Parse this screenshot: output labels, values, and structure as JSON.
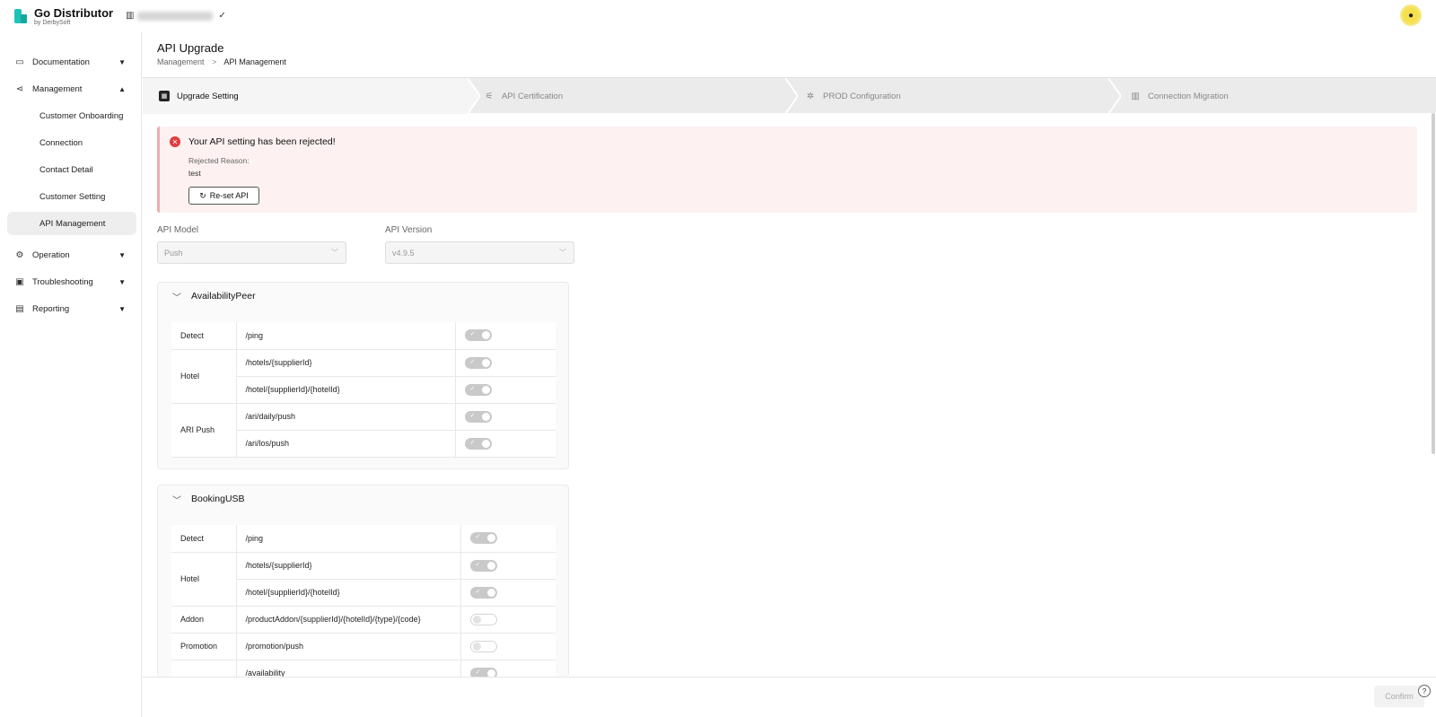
{
  "app": {
    "title": "Go Distributor",
    "subtitle": "by DerbySoft"
  },
  "org": {
    "icon": "building-icon",
    "check": "✓"
  },
  "sidebar": {
    "items": [
      {
        "label": "Documentation",
        "icon": "folder-icon",
        "caret": "▼"
      },
      {
        "label": "Management",
        "icon": "share-icon",
        "caret": "▲"
      },
      {
        "label": "Operation",
        "icon": "gear-icon",
        "caret": "▼"
      },
      {
        "label": "Troubleshooting",
        "icon": "monitor-icon",
        "caret": "▼"
      },
      {
        "label": "Reporting",
        "icon": "chart-icon",
        "caret": "▼"
      }
    ],
    "sub_items": [
      {
        "label": "Customer Onboarding"
      },
      {
        "label": "Connection"
      },
      {
        "label": "Contact Detail"
      },
      {
        "label": "Customer Setting"
      },
      {
        "label": "API Management"
      }
    ]
  },
  "header": {
    "title": "API Upgrade",
    "breadcrumb": {
      "parent": "Management",
      "sep": ">",
      "current": "API Management"
    }
  },
  "steps": [
    {
      "label": "Upgrade Setting"
    },
    {
      "label": "API Certification"
    },
    {
      "label": "PROD Configuration"
    },
    {
      "label": "Connection Migration"
    }
  ],
  "alert": {
    "title": "Your API setting has been rejected!",
    "reason_label": "Rejected Reason:",
    "reason_value": "test",
    "reset_button": "Re-set API"
  },
  "form": {
    "api_model_label": "API Model",
    "api_model_value": "Push",
    "api_version_label": "API Version",
    "api_version_value": "v4.9.5"
  },
  "panels": [
    {
      "title": "AvailabilityPeer",
      "groups": [
        "Detect",
        "Hotel",
        "ARI Push"
      ],
      "rows": [
        {
          "path": "/ping",
          "on": true
        },
        {
          "path": "/hotels/{supplierId}",
          "on": true
        },
        {
          "path": "/hotel/{supplierId}/{hotelId}",
          "on": true
        },
        {
          "path": "/ari/daily/push",
          "on": true
        },
        {
          "path": "/ari/los/push",
          "on": true
        }
      ]
    },
    {
      "title": "BookingUSB",
      "groups": [
        "Detect",
        "Hotel",
        "Addon",
        "Promotion"
      ],
      "rows": [
        {
          "path": "/ping",
          "on": true
        },
        {
          "path": "/hotels/{supplierId}",
          "on": true
        },
        {
          "path": "/hotel/{supplierId}/{hotelId}",
          "on": true
        },
        {
          "path": "/productAddon/{supplierId}/{hotelId}/{type}/{code}",
          "on": false
        },
        {
          "path": "/promotion/push",
          "on": false
        },
        {
          "path": "/availability",
          "on": true
        }
      ]
    }
  ],
  "footer": {
    "confirm": "Confirm",
    "help": "?"
  }
}
